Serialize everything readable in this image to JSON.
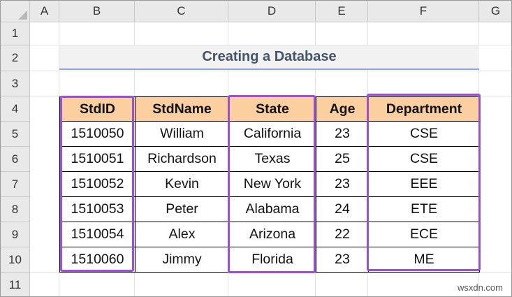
{
  "columns": [
    "A",
    "B",
    "C",
    "D",
    "E",
    "F",
    "G"
  ],
  "rows": [
    "1",
    "2",
    "3",
    "4",
    "5",
    "6",
    "7",
    "8",
    "9",
    "10",
    "11"
  ],
  "title": "Creating a Database",
  "table": {
    "headers": [
      "StdID",
      "StdName",
      "State",
      "Age",
      "Department"
    ],
    "rows": [
      [
        "1510050",
        "William",
        "California",
        "23",
        "CSE"
      ],
      [
        "1510051",
        "Richardson",
        "Texas",
        "25",
        "CSE"
      ],
      [
        "1510052",
        "Kevin",
        "New York",
        "23",
        "EEE"
      ],
      [
        "1510053",
        "Peter",
        "Alabama",
        "24",
        "ETE"
      ],
      [
        "1510054",
        "Alex",
        "Arizona",
        "22",
        "ECE"
      ],
      [
        "1510060",
        "Jimmy",
        "Florida",
        "23",
        "ME"
      ]
    ]
  },
  "highlighted_columns": [
    "StdID",
    "State",
    "Department"
  ],
  "colors": {
    "header_fill": "#fbcfa0",
    "highlight_border": "#9d4ed8",
    "title_text": "#44546a",
    "title_underline": "#8eaadb"
  },
  "watermark": "wsxdn.com"
}
